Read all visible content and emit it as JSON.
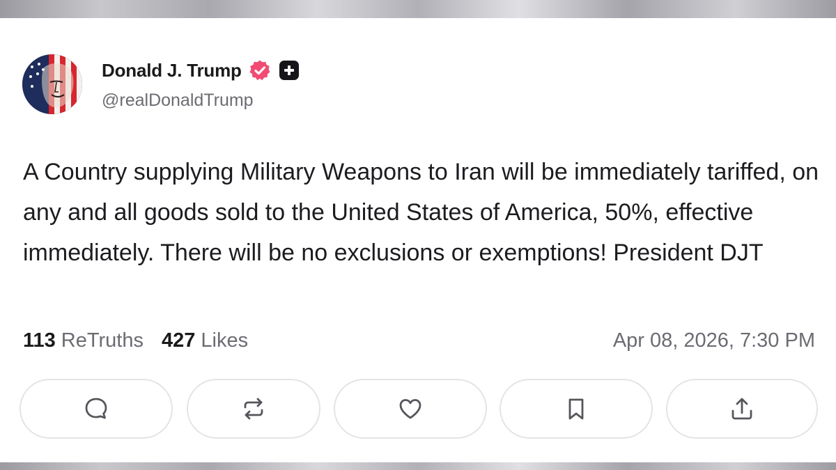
{
  "author": {
    "name": "Donald J. Trump",
    "handle": "@realDonaldTrump",
    "avatar_icon": "avatar-flag-portrait",
    "verified_color": "#f24b73"
  },
  "post": {
    "text": "A Country supplying Military Weapons to Iran will be immediately tariffed, on any and all goods sold to the United States of America, 50%, effective immediately. There will be no exclusions or exemptions! President DJT"
  },
  "stats": {
    "retruths_count": "113",
    "retruths_label": "ReTruths",
    "likes_count": "427",
    "likes_label": "Likes",
    "timestamp": "Apr 08, 2026, 7:30 PM"
  },
  "actions": [
    {
      "icon": "comment-icon"
    },
    {
      "icon": "retruth-icon"
    },
    {
      "icon": "like-heart-icon"
    },
    {
      "icon": "bookmark-icon"
    },
    {
      "icon": "share-icon"
    }
  ]
}
